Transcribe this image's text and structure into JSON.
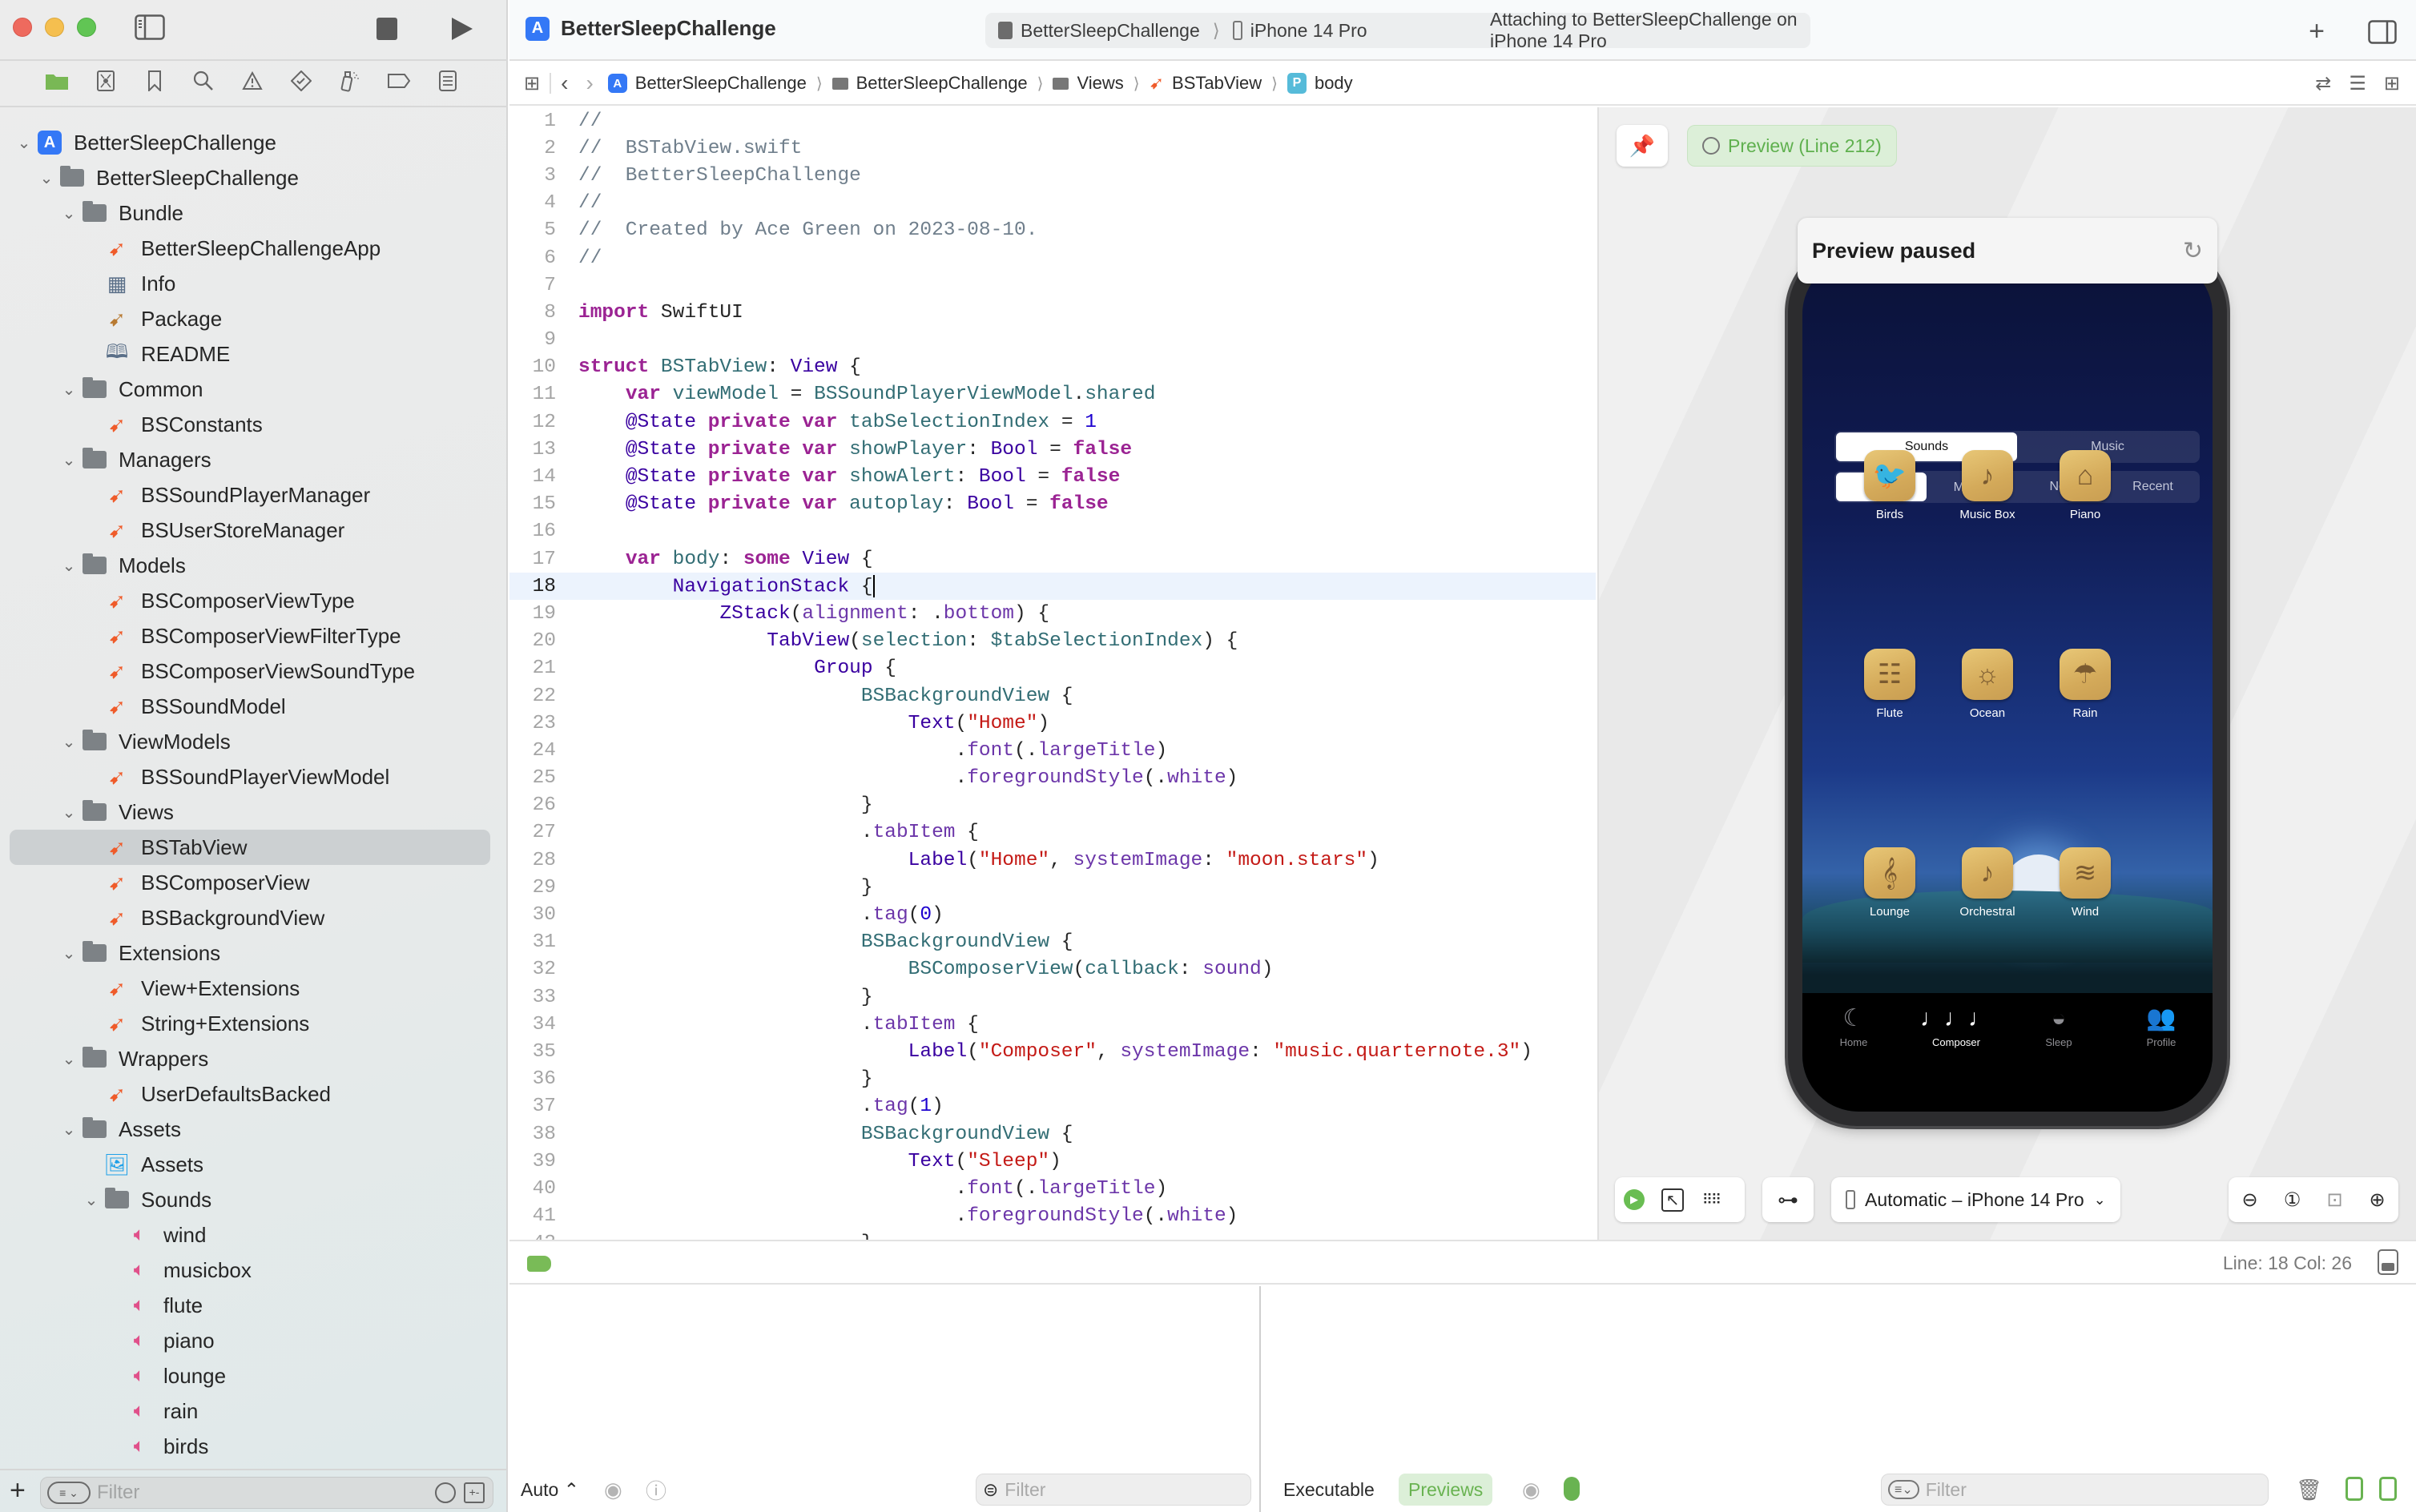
{
  "window": {
    "app_title": "BetterSleepChallenge",
    "activity": {
      "scheme": "BetterSleepChallenge",
      "device": "iPhone 14 Pro",
      "status": "Attaching to BetterSleepChallenge on iPhone 14 Pro"
    }
  },
  "navigator": {
    "tabs": [
      "project-navigator",
      "source-control",
      "bookmarks",
      "find",
      "issues",
      "tests",
      "debug",
      "breakpoints",
      "reports"
    ],
    "tree": [
      {
        "label": "BetterSleepChallenge",
        "level": 0,
        "kind": "project",
        "expanded": true
      },
      {
        "label": "BetterSleepChallenge",
        "level": 1,
        "kind": "folder",
        "expanded": true
      },
      {
        "label": "Bundle",
        "level": 2,
        "kind": "folder",
        "expanded": true
      },
      {
        "label": "BetterSleepChallengeApp",
        "level": 3,
        "kind": "swift"
      },
      {
        "label": "Info",
        "level": 3,
        "kind": "plist"
      },
      {
        "label": "Package",
        "level": 3,
        "kind": "package"
      },
      {
        "label": "README",
        "level": 3,
        "kind": "readme"
      },
      {
        "label": "Common",
        "level": 2,
        "kind": "folder",
        "expanded": true
      },
      {
        "label": "BSConstants",
        "level": 3,
        "kind": "swift"
      },
      {
        "label": "Managers",
        "level": 2,
        "kind": "folder",
        "expanded": true
      },
      {
        "label": "BSSoundPlayerManager",
        "level": 3,
        "kind": "swift"
      },
      {
        "label": "BSUserStoreManager",
        "level": 3,
        "kind": "swift"
      },
      {
        "label": "Models",
        "level": 2,
        "kind": "folder",
        "expanded": true
      },
      {
        "label": "BSComposerViewType",
        "level": 3,
        "kind": "swift"
      },
      {
        "label": "BSComposerViewFilterType",
        "level": 3,
        "kind": "swift"
      },
      {
        "label": "BSComposerViewSoundType",
        "level": 3,
        "kind": "swift"
      },
      {
        "label": "BSSoundModel",
        "level": 3,
        "kind": "swift"
      },
      {
        "label": "ViewModels",
        "level": 2,
        "kind": "folder",
        "expanded": true
      },
      {
        "label": "BSSoundPlayerViewModel",
        "level": 3,
        "kind": "swift"
      },
      {
        "label": "Views",
        "level": 2,
        "kind": "folder",
        "expanded": true
      },
      {
        "label": "BSTabView",
        "level": 3,
        "kind": "swift",
        "selected": true
      },
      {
        "label": "BSComposerView",
        "level": 3,
        "kind": "swift"
      },
      {
        "label": "BSBackgroundView",
        "level": 3,
        "kind": "swift"
      },
      {
        "label": "Extensions",
        "level": 2,
        "kind": "folder",
        "expanded": true
      },
      {
        "label": "View+Extensions",
        "level": 3,
        "kind": "swift"
      },
      {
        "label": "String+Extensions",
        "level": 3,
        "kind": "swift"
      },
      {
        "label": "Wrappers",
        "level": 2,
        "kind": "folder",
        "expanded": true
      },
      {
        "label": "UserDefaultsBacked",
        "level": 3,
        "kind": "swift"
      },
      {
        "label": "Assets",
        "level": 2,
        "kind": "folder",
        "expanded": true
      },
      {
        "label": "Assets",
        "level": 3,
        "kind": "assets"
      },
      {
        "label": "Sounds",
        "level": 3,
        "kind": "folder",
        "expanded": true
      },
      {
        "label": "wind",
        "level": 4,
        "kind": "audio"
      },
      {
        "label": "musicbox",
        "level": 4,
        "kind": "audio"
      },
      {
        "label": "flute",
        "level": 4,
        "kind": "audio"
      },
      {
        "label": "piano",
        "level": 4,
        "kind": "audio"
      },
      {
        "label": "lounge",
        "level": 4,
        "kind": "audio"
      },
      {
        "label": "rain",
        "level": 4,
        "kind": "audio"
      },
      {
        "label": "birds",
        "level": 4,
        "kind": "audio"
      }
    ],
    "filter_placeholder": "Filter"
  },
  "jumpbar": {
    "crumbs": [
      "BetterSleepChallenge",
      "BetterSleepChallenge",
      "Views",
      "BSTabView",
      "body"
    ]
  },
  "editor": {
    "current_line": 18,
    "lines": [
      [
        [
          "c",
          "//"
        ]
      ],
      [
        [
          "c",
          "//  BSTabView.swift"
        ]
      ],
      [
        [
          "c",
          "//  BetterSleepChallenge"
        ]
      ],
      [
        [
          "c",
          "//"
        ]
      ],
      [
        [
          "c",
          "//  Created by Ace Green on 2023-08-10."
        ]
      ],
      [
        [
          "c",
          "//"
        ]
      ],
      [],
      [
        [
          "k",
          "import"
        ],
        [
          "x",
          " SwiftUI"
        ]
      ],
      [],
      [
        [
          "k",
          "struct"
        ],
        [
          "p",
          " BSTabView"
        ],
        [
          "x",
          ": "
        ],
        [
          "t",
          "View"
        ],
        [
          "x",
          " {"
        ]
      ],
      [
        [
          "x",
          "    "
        ],
        [
          "k",
          "var"
        ],
        [
          "p",
          " viewModel"
        ],
        [
          "x",
          " = "
        ],
        [
          "p",
          "BSSoundPlayerViewModel"
        ],
        [
          "x",
          "."
        ],
        [
          "p",
          "shared"
        ]
      ],
      [
        [
          "x",
          "    "
        ],
        [
          "t",
          "@State"
        ],
        [
          "k",
          " private var"
        ],
        [
          "p",
          " tabSelectionIndex"
        ],
        [
          "x",
          " = "
        ],
        [
          "n",
          "1"
        ]
      ],
      [
        [
          "x",
          "    "
        ],
        [
          "t",
          "@State"
        ],
        [
          "k",
          " private var"
        ],
        [
          "p",
          " showPlayer"
        ],
        [
          "x",
          ": "
        ],
        [
          "t",
          "Bool"
        ],
        [
          "x",
          " = "
        ],
        [
          "k",
          "false"
        ]
      ],
      [
        [
          "x",
          "    "
        ],
        [
          "t",
          "@State"
        ],
        [
          "k",
          " private var"
        ],
        [
          "p",
          " showAlert"
        ],
        [
          "x",
          ": "
        ],
        [
          "t",
          "Bool"
        ],
        [
          "x",
          " = "
        ],
        [
          "k",
          "false"
        ]
      ],
      [
        [
          "x",
          "    "
        ],
        [
          "t",
          "@State"
        ],
        [
          "k",
          " private var"
        ],
        [
          "p",
          " autoplay"
        ],
        [
          "x",
          ": "
        ],
        [
          "t",
          "Bool"
        ],
        [
          "x",
          " = "
        ],
        [
          "k",
          "false"
        ]
      ],
      [],
      [
        [
          "x",
          "    "
        ],
        [
          "k",
          "var"
        ],
        [
          "p",
          " body"
        ],
        [
          "x",
          ": "
        ],
        [
          "k",
          "some"
        ],
        [
          "t",
          " View"
        ],
        [
          "x",
          " {"
        ]
      ],
      [
        [
          "x",
          "        "
        ],
        [
          "t",
          "NavigationStack"
        ],
        [
          "x",
          " {"
        ],
        [
          "cursor",
          ""
        ]
      ],
      [
        [
          "x",
          "            "
        ],
        [
          "t",
          "ZStack"
        ],
        [
          "x",
          "("
        ],
        [
          "fn",
          "alignment"
        ],
        [
          "x",
          ": ."
        ],
        [
          "fn",
          "bottom"
        ],
        [
          "x",
          ") {"
        ]
      ],
      [
        [
          "x",
          "                "
        ],
        [
          "t",
          "TabView"
        ],
        [
          "x",
          "("
        ],
        [
          "p",
          "selection"
        ],
        [
          "x",
          ": "
        ],
        [
          "p",
          "$tabSelectionIndex"
        ],
        [
          "x",
          ") {"
        ]
      ],
      [
        [
          "x",
          "                    "
        ],
        [
          "t",
          "Group"
        ],
        [
          "x",
          " {"
        ]
      ],
      [
        [
          "x",
          "                        "
        ],
        [
          "p",
          "BSBackgroundView"
        ],
        [
          "x",
          " {"
        ]
      ],
      [
        [
          "x",
          "                            "
        ],
        [
          "t",
          "Text"
        ],
        [
          "x",
          "("
        ],
        [
          "s",
          "\"Home\""
        ],
        [
          "x",
          ")"
        ]
      ],
      [
        [
          "x",
          "                                ."
        ],
        [
          "fn",
          "font"
        ],
        [
          "x",
          "(."
        ],
        [
          "fn",
          "largeTitle"
        ],
        [
          "x",
          ")"
        ]
      ],
      [
        [
          "x",
          "                                ."
        ],
        [
          "fn",
          "foregroundStyle"
        ],
        [
          "x",
          "(."
        ],
        [
          "fn",
          "white"
        ],
        [
          "x",
          ")"
        ]
      ],
      [
        [
          "x",
          "                        }"
        ]
      ],
      [
        [
          "x",
          "                        ."
        ],
        [
          "fn",
          "tabItem"
        ],
        [
          "x",
          " {"
        ]
      ],
      [
        [
          "x",
          "                            "
        ],
        [
          "t",
          "Label"
        ],
        [
          "x",
          "("
        ],
        [
          "s",
          "\"Home\""
        ],
        [
          "x",
          ", "
        ],
        [
          "fn",
          "systemImage"
        ],
        [
          "x",
          ": "
        ],
        [
          "s",
          "\"moon.stars\""
        ],
        [
          "x",
          ")"
        ]
      ],
      [
        [
          "x",
          "                        }"
        ]
      ],
      [
        [
          "x",
          "                        ."
        ],
        [
          "fn",
          "tag"
        ],
        [
          "x",
          "("
        ],
        [
          "n",
          "0"
        ],
        [
          "x",
          ")"
        ]
      ],
      [
        [
          "x",
          "                        "
        ],
        [
          "p",
          "BSBackgroundView"
        ],
        [
          "x",
          " {"
        ]
      ],
      [
        [
          "x",
          "                            "
        ],
        [
          "p",
          "BSComposerView"
        ],
        [
          "x",
          "("
        ],
        [
          "p",
          "callback"
        ],
        [
          "x",
          ": "
        ],
        [
          "fn",
          "sound"
        ],
        [
          "x",
          ")"
        ]
      ],
      [
        [
          "x",
          "                        }"
        ]
      ],
      [
        [
          "x",
          "                        ."
        ],
        [
          "fn",
          "tabItem"
        ],
        [
          "x",
          " {"
        ]
      ],
      [
        [
          "x",
          "                            "
        ],
        [
          "t",
          "Label"
        ],
        [
          "x",
          "("
        ],
        [
          "s",
          "\"Composer\""
        ],
        [
          "x",
          ", "
        ],
        [
          "fn",
          "systemImage"
        ],
        [
          "x",
          ": "
        ],
        [
          "s",
          "\"music.quarternote.3\""
        ],
        [
          "x",
          ")"
        ]
      ],
      [
        [
          "x",
          "                        }"
        ]
      ],
      [
        [
          "x",
          "                        ."
        ],
        [
          "fn",
          "tag"
        ],
        [
          "x",
          "("
        ],
        [
          "n",
          "1"
        ],
        [
          "x",
          ")"
        ]
      ],
      [
        [
          "x",
          "                        "
        ],
        [
          "p",
          "BSBackgroundView"
        ],
        [
          "x",
          " {"
        ]
      ],
      [
        [
          "x",
          "                            "
        ],
        [
          "t",
          "Text"
        ],
        [
          "x",
          "("
        ],
        [
          "s",
          "\"Sleep\""
        ],
        [
          "x",
          ")"
        ]
      ],
      [
        [
          "x",
          "                                ."
        ],
        [
          "fn",
          "font"
        ],
        [
          "x",
          "(."
        ],
        [
          "fn",
          "largeTitle"
        ],
        [
          "x",
          ")"
        ]
      ],
      [
        [
          "x",
          "                                ."
        ],
        [
          "fn",
          "foregroundStyle"
        ],
        [
          "x",
          "(."
        ],
        [
          "fn",
          "white"
        ],
        [
          "x",
          ")"
        ]
      ],
      [
        [
          "x",
          "                        }"
        ]
      ]
    ]
  },
  "canvas": {
    "preview_chip": "Preview (Line 212)",
    "paused_title": "Preview paused",
    "device_selector": "Automatic – iPhone 14 Pro",
    "app": {
      "segment_primary": [
        {
          "label": "Sounds",
          "active": true
        },
        {
          "label": "Music",
          "active": false
        }
      ],
      "segment_filter": [
        {
          "label": "All",
          "active": true
        },
        {
          "label": "My ❤️",
          "active": false
        },
        {
          "label": "New",
          "active": false
        },
        {
          "label": "Recent",
          "active": false
        }
      ],
      "sounds": [
        {
          "label": "Birds",
          "glyph": "🐦"
        },
        {
          "label": "Music Box",
          "glyph": "♪"
        },
        {
          "label": "Piano",
          "glyph": "⌂"
        },
        {
          "label": "Flute",
          "glyph": "☷"
        },
        {
          "label": "Ocean",
          "glyph": "☼"
        },
        {
          "label": "Rain",
          "glyph": "☂"
        },
        {
          "label": "Lounge",
          "glyph": "𝄞"
        },
        {
          "label": "Orchestral",
          "glyph": "♪"
        },
        {
          "label": "Wind",
          "glyph": "≋"
        }
      ],
      "tabbar": [
        {
          "label": "Home",
          "icon": "☾",
          "active": false
        },
        {
          "label": "Composer",
          "icon": "♩♩♩",
          "active": true
        },
        {
          "label": "Sleep",
          "icon": "◒",
          "active": false
        },
        {
          "label": "Profile",
          "icon": "👥",
          "active": false
        }
      ]
    }
  },
  "status_bar": {
    "line_col": "Line: 18  Col: 26"
  },
  "debug_bar": {
    "variables_mode": "Auto ⌃",
    "variables_filter_placeholder": "Filter",
    "console_source_executable": "Executable",
    "console_source_previews": "Previews",
    "console_filter_placeholder": "Filter"
  },
  "colors": {
    "accent_green": "#69b351",
    "swift_orange": "#ef5b2a",
    "audio_pink": "#e0508a",
    "xcode_blue": "#3478f6"
  }
}
